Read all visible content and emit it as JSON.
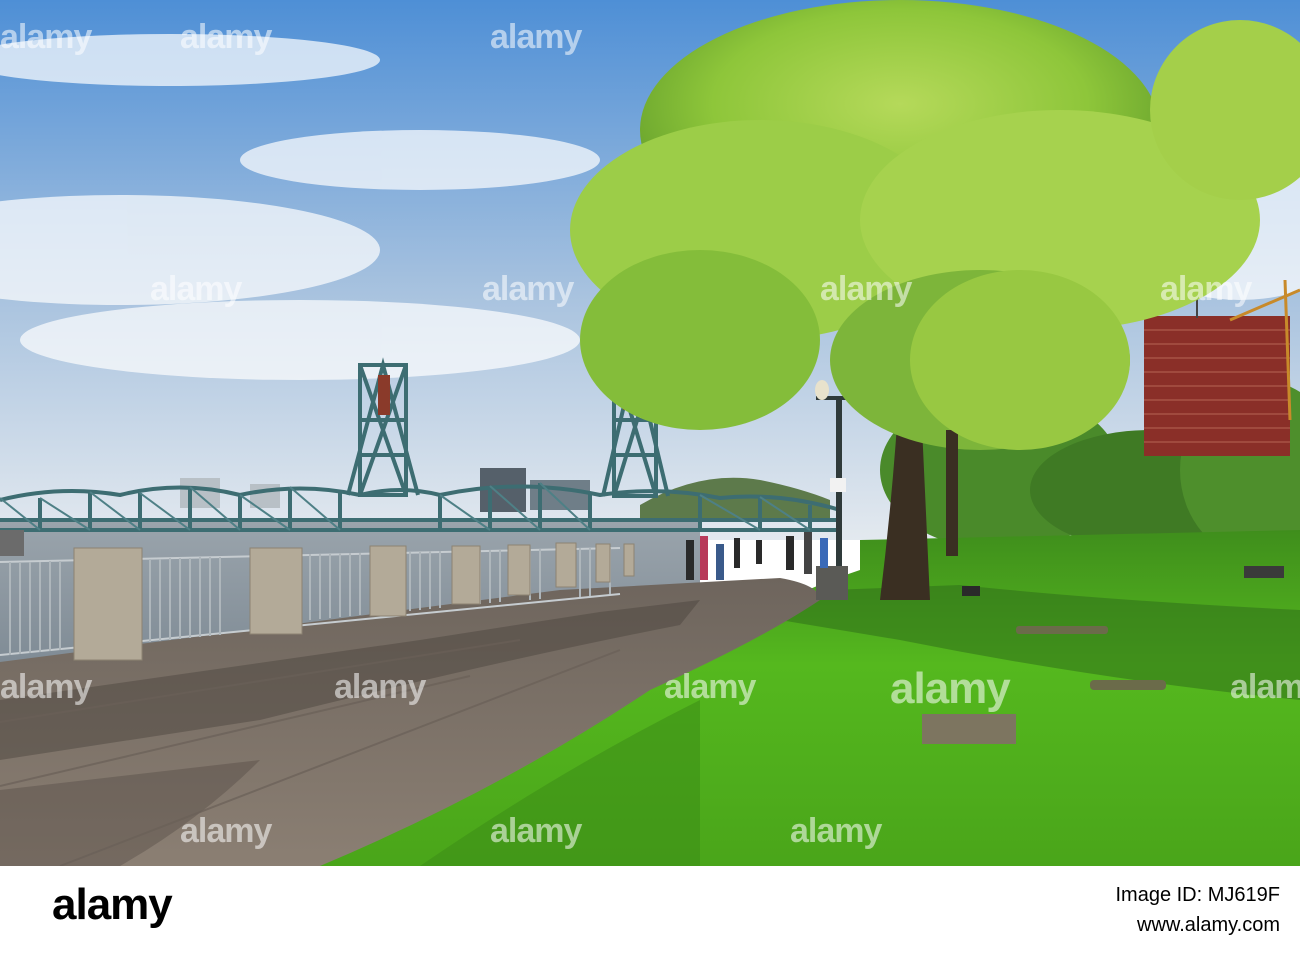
{
  "scene": {
    "colors": {
      "sky_top": "#5f9ad8",
      "sky_bottom": "#dfe6ee",
      "river": "#8a96a0",
      "bridge": "#3d6d72",
      "walkway": "#807469",
      "walkway_shadow": "#4a423c",
      "grass_lit": "#4fb51c",
      "grass_shade": "#2f6f19",
      "tree_foliage": "#8ec63a",
      "tree_trunk": "#3a2f22",
      "building": "#8a2f28"
    }
  },
  "watermarks": {
    "brand": "alamy"
  },
  "footer": {
    "logo_text": "alamy",
    "image_id": "Image ID: MJ619F",
    "url": "www.alamy.com"
  }
}
